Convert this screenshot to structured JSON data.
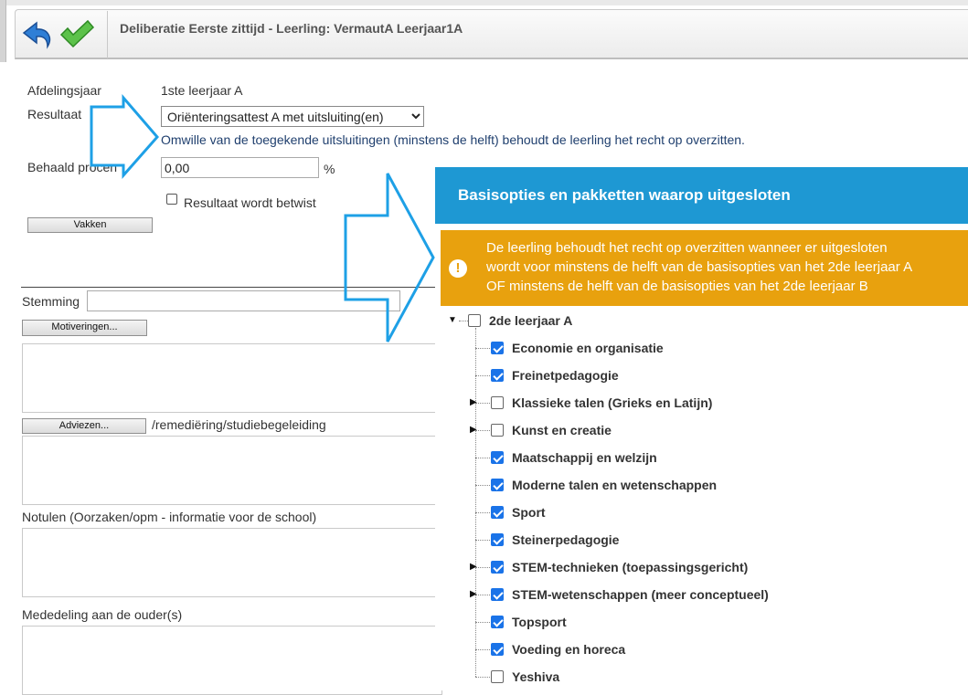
{
  "window": {
    "title": "Deliberatie Eerste zittijd - Leerling: VermautA Leerjaar1A"
  },
  "toolbar": {
    "undo_icon": "undo-icon",
    "confirm_icon": "checkmark-icon"
  },
  "form": {
    "afdelingsjaar_label": "Afdelingsjaar",
    "afdelingsjaar_value": "1ste leerjaar A",
    "resultaat_label": "Resultaat",
    "resultaat_value": "Oriënteringsattest A met uitsluiting(en)",
    "resultaat_note": "Omwille van de toegekende uitsluitingen (minstens de helft) behoudt de leerling het recht op overzitten.",
    "behaald_label": "Behaald procen",
    "behaald_value": "0,00",
    "percent_sign": "%",
    "betwist_label": "Resultaat wordt betwist",
    "vakken_button": "Vakken",
    "stemming_label": "Stemming",
    "motiveringen_button": "Motiveringen...",
    "adviezen_button": "Adviezen...",
    "adviezen_label": "/remediëring/studiebegeleiding",
    "notulen_label": "Notulen (Oorzaken/opm - informatie voor de school)",
    "mededeling_label": "Mededeling aan de ouder(s)"
  },
  "popup": {
    "title": "Basisopties en pakketten waarop uitgesloten",
    "warning_lines": [
      "De leerling behoudt het recht op overzitten wanneer er uitgesloten",
      "wordt voor minstens de helft van de basisopties van het 2de leerjaar A",
      "OF minstens de helft van de basisopties van het 2de leerjaar B"
    ],
    "tree_root": {
      "label": "2de leerjaar A",
      "checked": false,
      "expanded": true
    },
    "tree_items": [
      {
        "label": "Economie en organisatie",
        "checked": true,
        "expandable": false
      },
      {
        "label": "Freinetpedagogie",
        "checked": true,
        "expandable": false
      },
      {
        "label": "Klassieke talen (Grieks en Latijn)",
        "checked": false,
        "expandable": true
      },
      {
        "label": "Kunst en creatie",
        "checked": false,
        "expandable": true
      },
      {
        "label": "Maatschappij en welzijn",
        "checked": true,
        "expandable": false
      },
      {
        "label": "Moderne talen en wetenschappen",
        "checked": true,
        "expandable": false
      },
      {
        "label": "Sport",
        "checked": true,
        "expandable": false
      },
      {
        "label": "Steinerpedagogie",
        "checked": true,
        "expandable": false
      },
      {
        "label": "STEM-technieken (toepassingsgericht)",
        "checked": true,
        "expandable": true
      },
      {
        "label": "STEM-wetenschappen (meer conceptueel)",
        "checked": true,
        "expandable": true
      },
      {
        "label": "Topsport",
        "checked": true,
        "expandable": false
      },
      {
        "label": "Voeding en horeca",
        "checked": true,
        "expandable": false
      },
      {
        "label": "Yeshiva",
        "checked": false,
        "expandable": false
      }
    ]
  },
  "annotation_color": "#1ea0e6"
}
